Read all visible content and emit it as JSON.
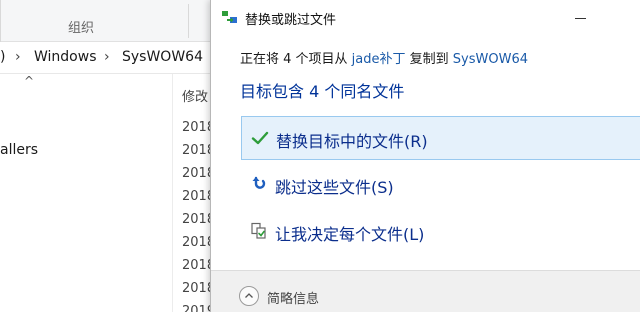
{
  "explorer": {
    "ribbon": {
      "group_label": "组织"
    },
    "address": {
      "crumb_partial": ")",
      "crumbs": [
        "Windows",
        "SysWOW64"
      ]
    },
    "nav": {
      "scroll_up_glyph": "^",
      "item_label": "allers"
    },
    "list": {
      "column_header": "修改",
      "dates": [
        "2018",
        "2018",
        "2018",
        "2018",
        "2018",
        "2018",
        "2018",
        "2018",
        "2019"
      ]
    }
  },
  "dialog": {
    "title": "替换或跳过文件",
    "desc_prefix": "正在将 4 个项目从 ",
    "desc_source": "jade补丁",
    "desc_middle": " 复制到 ",
    "desc_dest": "SysWOW64",
    "heading": "目标包含 4 个同名文件",
    "options": [
      {
        "label": "替换目标中的文件(R)",
        "icon": "check-icon",
        "selected": true
      },
      {
        "label": "跳过这些文件(S)",
        "icon": "skip-arrow-icon",
        "selected": false
      },
      {
        "label": "让我决定每个文件(L)",
        "icon": "decide-files-icon",
        "selected": false
      }
    ],
    "footer_label": "简略信息"
  },
  "colors": {
    "heading_blue": "#003399",
    "option_blue": "#0b2e8c",
    "link_blue": "#1a5aa8",
    "selection_fill": "#e5f1fb",
    "check_green": "#2e9d3a",
    "skip_blue": "#1f5fbf"
  }
}
